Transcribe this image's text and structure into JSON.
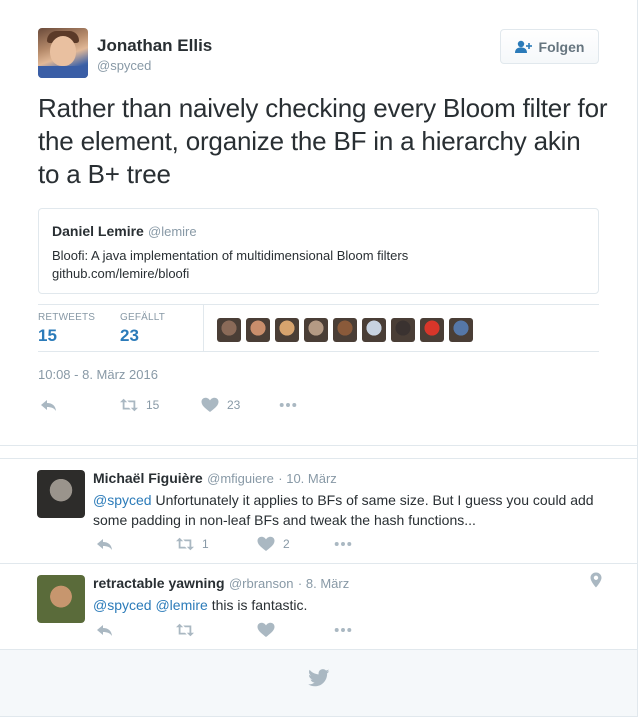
{
  "tweet": {
    "author_name": "Jonathan Ellis",
    "author_handle": "@spyced",
    "follow_label": "Folgen",
    "text": "Rather than naively checking every Bloom filter for the element, organize the BF in a hierarchy akin to a B+ tree",
    "quote": {
      "name": "Daniel Lemire",
      "handle": "@lemire",
      "text_line1": "Bloofi: A java implementation of multidimensional Bloom filters",
      "text_line2": "github.com/lemire/bloofi"
    },
    "stats": {
      "retweets_label": "RETWEETS",
      "retweets_value": "15",
      "likes_label": "GEFÄLLT",
      "likes_value": "23"
    },
    "likers": [
      "#8a6a58",
      "#c98e6c",
      "#d6a36e",
      "#b49a84",
      "#8a5a3a",
      "#c7d2e0",
      "#3a3230",
      "#d8362a",
      "#5577a8"
    ],
    "timestamp": "10:08 - 8. März 2016",
    "actions": {
      "retweet_count": "15",
      "like_count": "23"
    }
  },
  "replies": [
    {
      "name": "Michaël Figuière",
      "handle": "@mfiguiere",
      "date": "· 10. März",
      "mention": "@spyced",
      "text": " Unfortunately it applies to BFs of same size. But I guess you could add some padding in non-leaf BFs and tweak the hash functions...",
      "retweet_count": "1",
      "like_count": "2"
    },
    {
      "name": "retractable yawning",
      "handle": "@rbranson",
      "date": "· 8. März",
      "mention1": "@spyced",
      "mention2": "@lemire",
      "text": " this is fantastic.",
      "retweet_count": "",
      "like_count": ""
    }
  ],
  "colors": {
    "accent": "#2b7bb9",
    "muted": "#8899a6",
    "border": "#e1e8ed",
    "footer": "#f5f8fa"
  },
  "icons": [
    "follow-user-icon",
    "reply-icon",
    "retweet-icon",
    "heart-icon",
    "more-icon",
    "location-icon",
    "twitter-bird-icon"
  ]
}
